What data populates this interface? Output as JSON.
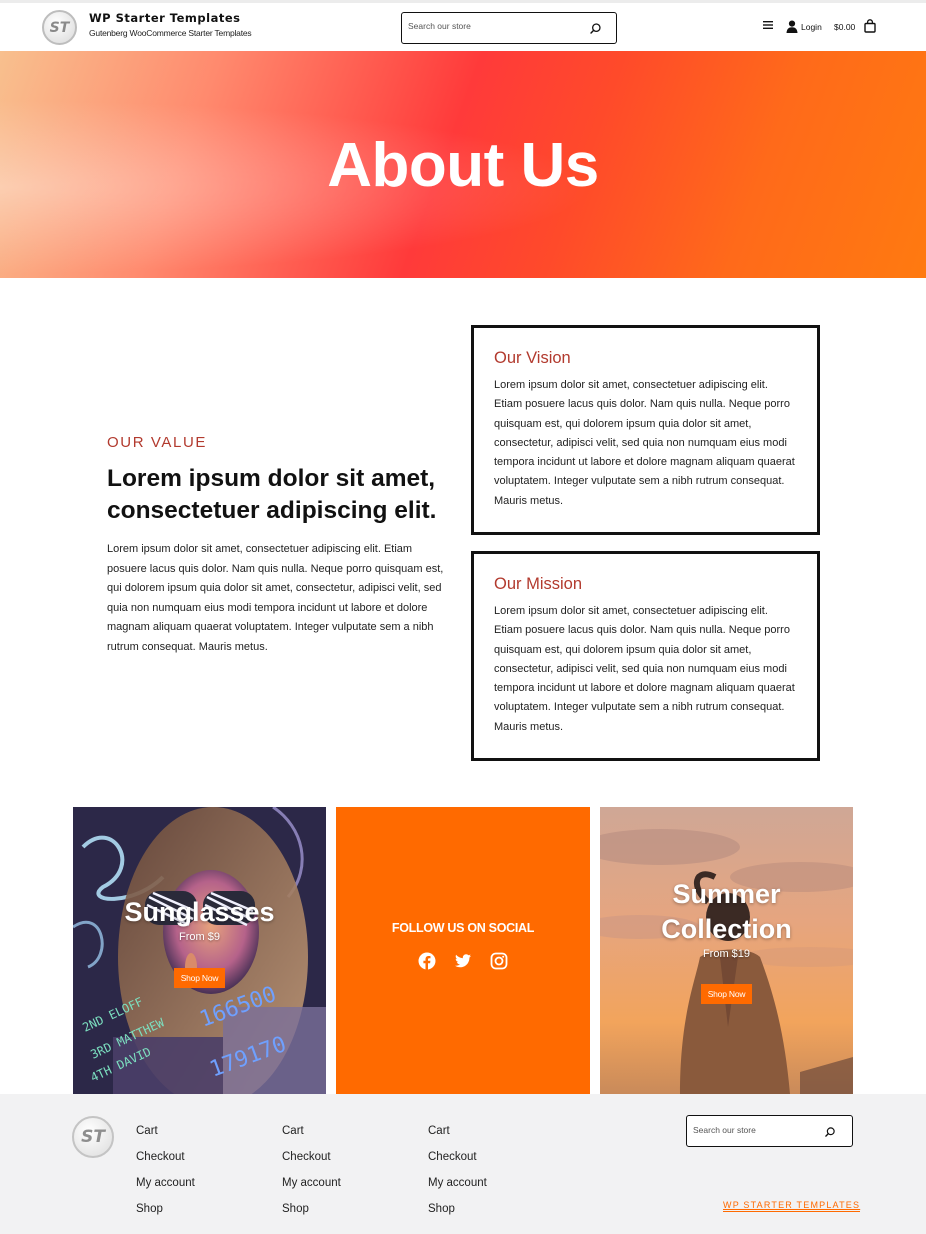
{
  "header": {
    "logo_text": "ST",
    "site_title": "WP Starter Templates",
    "tagline": "Gutenberg WooCommerce Starter Templates",
    "search_placeholder": "Search our store",
    "login_label": "Login",
    "cart_total": "$0.00"
  },
  "hero": {
    "title": "About Us"
  },
  "value": {
    "eyebrow": "OUR VALUE",
    "heading": "Lorem ipsum dolor sit amet, consectetuer adipiscing elit.",
    "body": "Lorem ipsum dolor sit amet, consectetuer adipiscing elit. Etiam posuere lacus quis dolor. Nam quis nulla. Neque porro quisquam est, qui dolorem ipsum quia dolor sit amet, consectetur, adipisci velit, sed quia non numquam eius modi tempora incidunt ut labore et dolore magnam aliquam quaerat voluptatem. Integer vulputate sem a nibh rutrum consequat. Mauris metus."
  },
  "vision": {
    "title": "Our Vision",
    "body": "Lorem ipsum dolor sit amet, consectetuer adipiscing elit. Etiam posuere lacus quis dolor. Nam quis nulla. Neque porro quisquam est, qui dolorem ipsum quia dolor sit amet, consectetur, adipisci velit, sed quia non numquam eius modi tempora incidunt ut labore et dolore magnam aliquam quaerat voluptatem. Integer vulputate sem a nibh rutrum consequat. Mauris metus."
  },
  "mission": {
    "title": "Our Mission",
    "body": "Lorem ipsum dolor sit amet, consectetuer adipiscing elit. Etiam posuere lacus quis dolor. Nam quis nulla. Neque porro quisquam est, qui dolorem ipsum quia dolor sit amet, consectetur, adipisci velit, sed quia non numquam eius modi tempora incidunt ut labore et dolore magnam aliquam quaerat voluptatem. Integer vulputate sem a nibh rutrum consequat. Mauris metus."
  },
  "tiles": {
    "sunglasses": {
      "title": "Sunglasses",
      "price": "From $9",
      "button": "Shop Now"
    },
    "social": {
      "title": "FOLLOW US ON SOCIAL",
      "icons": [
        "facebook-icon",
        "twitter-icon",
        "instagram-icon"
      ]
    },
    "summer": {
      "title_line1": "Summer",
      "title_line2": "Collection",
      "price": "From $19",
      "button": "Shop Now"
    }
  },
  "footer": {
    "logo_text": "ST",
    "columns": [
      [
        "Cart",
        "Checkout",
        "My account",
        "Shop"
      ],
      [
        "Cart",
        "Checkout",
        "My account",
        "Shop"
      ],
      [
        "Cart",
        "Checkout",
        "My account",
        "Shop"
      ]
    ],
    "search_placeholder": "Search our store",
    "brand_link": "WP STARTER TEMPLATES"
  },
  "colors": {
    "accent_orange": "#ff6a00",
    "heading_red": "#b23a2e",
    "footer_bg": "#f2f2f3"
  }
}
